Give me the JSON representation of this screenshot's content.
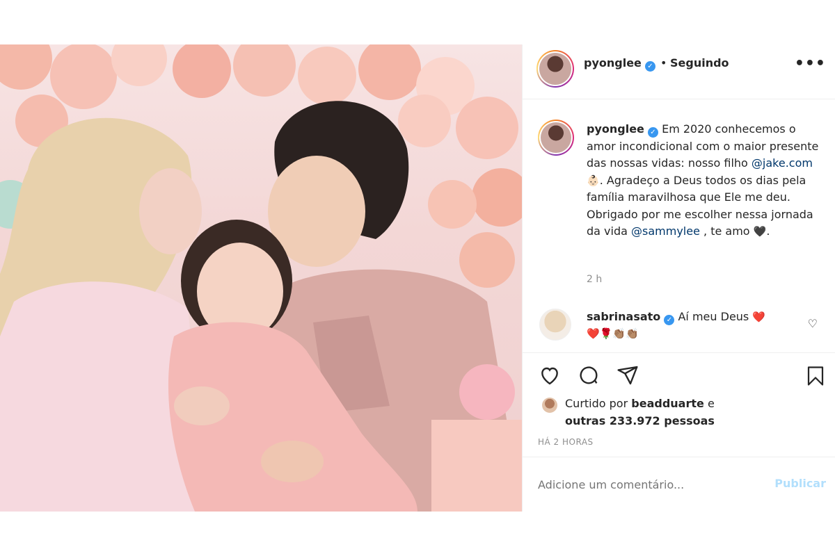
{
  "post": {
    "author": {
      "username": "pyonglee",
      "verified": true,
      "follow_status": "Seguindo"
    },
    "caption": {
      "text_1": "Em 2020 conhecemos o amor incondicional com o maior presente das nossas vidas: nosso filho",
      "mention_1": "@jake.com",
      "emoji_1": "👶🏻",
      "text_2": ". Agradeço a Deus todos os dias pela família maravilhosa que Ele me deu. Obrigado por me escolher nessa jornada da vida",
      "mention_2": "@sammylee",
      "text_3": ", te amo",
      "emoji_2": "🖤",
      "text_4": ".",
      "time_ago": "2 h"
    },
    "comment": {
      "username": "sabrinasato",
      "verified": true,
      "text": "Aí meu Deus",
      "emoji_line_1": "❤️",
      "emoji_line_2": "❤️🌹👏🏽👏🏽"
    },
    "likes": {
      "prefix": "Curtido por",
      "liked_user": "beadduarte",
      "conj": "e",
      "others": "outras 233.972 pessoas"
    },
    "date": "HÁ 2 HORAS",
    "add_comment": {
      "placeholder": "Adicione um comentário...",
      "publish_label": "Publicar"
    },
    "more_label": "•••",
    "dot": "•"
  },
  "icons": {
    "like": "heart-icon",
    "comment": "comment-icon",
    "share": "share-icon",
    "save": "bookmark-icon",
    "more": "more-icon",
    "verified": "verified-icon"
  },
  "colors": {
    "verified_blue": "#3897f0",
    "publish_disabled": "#b2dffc",
    "mention": "#00376b",
    "muted": "#8e8e8e"
  }
}
